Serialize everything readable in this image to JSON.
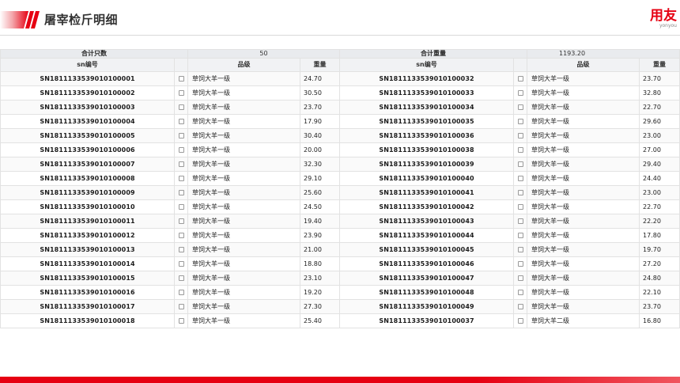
{
  "header": {
    "title": "屠宰检斤明细",
    "logo_main": "用友",
    "logo_sub": "yonyou",
    "accent_color": "#e60012"
  },
  "summary": {
    "count_label": "合计只数",
    "count_value": "50",
    "weight_label": "合计重量",
    "weight_value": "1193.20"
  },
  "columns": {
    "sn": "sn编号",
    "grade": "品级",
    "weight": "重量"
  },
  "left_rows": [
    {
      "sn": "SN1811133539010100001",
      "grade": "草饲大羊一级",
      "weight": "24.70"
    },
    {
      "sn": "SN1811133539010100002",
      "grade": "草饲大羊一级",
      "weight": "30.50"
    },
    {
      "sn": "SN1811133539010100003",
      "grade": "草饲大羊一级",
      "weight": "23.70"
    },
    {
      "sn": "SN1811133539010100004",
      "grade": "草饲大羊一级",
      "weight": "17.90"
    },
    {
      "sn": "SN1811133539010100005",
      "grade": "草饲大羊一级",
      "weight": "30.40"
    },
    {
      "sn": "SN1811133539010100006",
      "grade": "草饲大羊一级",
      "weight": "20.00"
    },
    {
      "sn": "SN1811133539010100007",
      "grade": "草饲大羊一级",
      "weight": "32.30"
    },
    {
      "sn": "SN1811133539010100008",
      "grade": "草饲大羊一级",
      "weight": "29.10"
    },
    {
      "sn": "SN1811133539010100009",
      "grade": "草饲大羊一级",
      "weight": "25.60"
    },
    {
      "sn": "SN1811133539010100010",
      "grade": "草饲大羊一级",
      "weight": "24.50"
    },
    {
      "sn": "SN1811133539010100011",
      "grade": "草饲大羊一级",
      "weight": "19.40"
    },
    {
      "sn": "SN1811133539010100012",
      "grade": "草饲大羊一级",
      "weight": "23.90"
    },
    {
      "sn": "SN1811133539010100013",
      "grade": "草饲大羊一级",
      "weight": "21.00"
    },
    {
      "sn": "SN1811133539010100014",
      "grade": "草饲大羊一级",
      "weight": "18.80"
    },
    {
      "sn": "SN1811133539010100015",
      "grade": "草饲大羊一级",
      "weight": "23.10"
    },
    {
      "sn": "SN1811133539010100016",
      "grade": "草饲大羊一级",
      "weight": "19.20"
    },
    {
      "sn": "SN1811133539010100017",
      "grade": "草饲大羊一级",
      "weight": "27.30"
    },
    {
      "sn": "SN1811133539010100018",
      "grade": "草饲大羊一级",
      "weight": "25.40"
    }
  ],
  "right_rows": [
    {
      "sn": "SN1811133539010100032",
      "grade": "草饲大羊一级",
      "weight": "23.70"
    },
    {
      "sn": "SN1811133539010100033",
      "grade": "草饲大羊一级",
      "weight": "32.80"
    },
    {
      "sn": "SN1811133539010100034",
      "grade": "草饲大羊一级",
      "weight": "22.70"
    },
    {
      "sn": "SN1811133539010100035",
      "grade": "草饲大羊一级",
      "weight": "29.60"
    },
    {
      "sn": "SN1811133539010100036",
      "grade": "草饲大羊一级",
      "weight": "23.00"
    },
    {
      "sn": "SN1811133539010100038",
      "grade": "草饲大羊一级",
      "weight": "27.00"
    },
    {
      "sn": "SN1811133539010100039",
      "grade": "草饲大羊一级",
      "weight": "29.40"
    },
    {
      "sn": "SN1811133539010100040",
      "grade": "草饲大羊一级",
      "weight": "24.40"
    },
    {
      "sn": "SN1811133539010100041",
      "grade": "草饲大羊一级",
      "weight": "23.00"
    },
    {
      "sn": "SN1811133539010100042",
      "grade": "草饲大羊一级",
      "weight": "22.70"
    },
    {
      "sn": "SN1811133539010100043",
      "grade": "草饲大羊一级",
      "weight": "22.20"
    },
    {
      "sn": "SN1811133539010100044",
      "grade": "草饲大羊一级",
      "weight": "17.80"
    },
    {
      "sn": "SN1811133539010100045",
      "grade": "草饲大羊一级",
      "weight": "19.70"
    },
    {
      "sn": "SN1811133539010100046",
      "grade": "草饲大羊一级",
      "weight": "27.20"
    },
    {
      "sn": "SN1811133539010100047",
      "grade": "草饲大羊一级",
      "weight": "24.80"
    },
    {
      "sn": "SN1811133539010100048",
      "grade": "草饲大羊一级",
      "weight": "22.10"
    },
    {
      "sn": "SN1811133539010100049",
      "grade": "草饲大羊一级",
      "weight": "23.70"
    },
    {
      "sn": "SN1811133539010100037",
      "grade": "草饲大羊二级",
      "weight": "16.80"
    }
  ]
}
